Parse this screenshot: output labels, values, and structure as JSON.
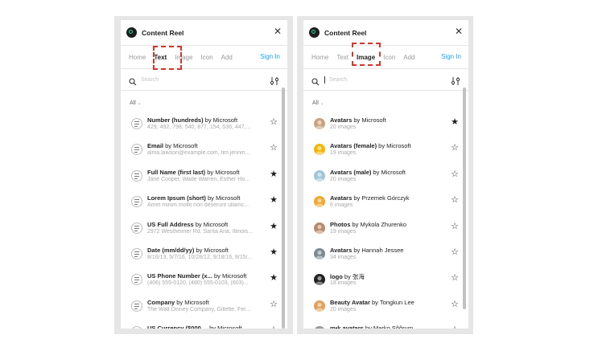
{
  "colors": {
    "accent": "#18a0fb",
    "highlight": "#d4362a",
    "frame": "#e6e6e6"
  },
  "panels": [
    {
      "title": "Content Reel",
      "close_icon": "close-icon",
      "tabs": [
        "Home",
        "Text",
        "Image",
        "Icon",
        "Add"
      ],
      "active_tab": "Text",
      "signin": "Sign In",
      "search_placeholder": "Search",
      "filter": "All",
      "items": [
        {
          "name": "Number (hundreds)",
          "by": " by Microsoft",
          "sub": "429, 492, 798, 540, 877, 154, 536, 447,...",
          "starred": false
        },
        {
          "name": "Email",
          "by": " by Microsoft",
          "sub": "alma.lawson@example.com, tim.jennin...",
          "starred": false
        },
        {
          "name": "Full Name (first last)",
          "by": " by Microsoft",
          "sub": "Jane Cooper, Wade Warren, Esther Ho...",
          "starred": true
        },
        {
          "name": "Lorem Ipsum (short)",
          "by": " by Microsoft",
          "sub": "Amet minim mollit non deserunt ullamc...",
          "starred": true
        },
        {
          "name": "US Full Address",
          "by": " by Microsoft",
          "sub": "2972 Westheimer Rd. Santa Ana, Illinois...",
          "starred": true
        },
        {
          "name": "Date (mm/dd/yy)",
          "by": " by Microsoft",
          "sub": "8/16/13, 5/7/16, 10/28/12, 9/18/16, 8/15/...",
          "starred": true
        },
        {
          "name": "US Phone Number (x...",
          "by": " by Microsoft",
          "sub": "(406) 555-0120, (480) 555-0103, (603)...",
          "starred": true
        },
        {
          "name": "Company",
          "by": " by Microsoft",
          "sub": "The Walt Disney Company, Gillette, Fer...",
          "starred": false
        },
        {
          "name": "US Currency ($000....",
          "by": " by Microsoft",
          "sub": "",
          "starred": false
        }
      ]
    },
    {
      "title": "Content Reel",
      "close_icon": "close-icon",
      "tabs": [
        "Home",
        "Text",
        "Image",
        "Icon",
        "Add"
      ],
      "active_tab": "Image",
      "signin": "Sign In",
      "search_placeholder": "Search",
      "filter": "All",
      "items": [
        {
          "name": "Avatars",
          "by": " by Microsoft",
          "sub": "20 images",
          "starred": true,
          "avatar": "#c9a27e"
        },
        {
          "name": "Avatars (female)",
          "by": " by Microsoft",
          "sub": "19 images",
          "starred": false,
          "avatar": "#f2b705"
        },
        {
          "name": "Avatars (male)",
          "by": " by Microsoft",
          "sub": "20 images",
          "starred": false,
          "avatar": "#9ec5d8"
        },
        {
          "name": "Avatars",
          "by": " by Przemek Górczyk",
          "sub": "6 images",
          "starred": false,
          "avatar": "#f0a830"
        },
        {
          "name": "Photos",
          "by": " by Mykola Zhurenko",
          "sub": "19 images",
          "starred": false,
          "avatar": "#b88a6b"
        },
        {
          "name": "Avatars",
          "by": " by Hannah Jessee",
          "sub": "34 images",
          "starred": false,
          "avatar": "#7d8a91"
        },
        {
          "name": "logo",
          "by": " by 张海",
          "sub": "18 images",
          "starred": false,
          "avatar": "#222222"
        },
        {
          "name": "Beauty Avatar",
          "by": " by Tongkun Lee",
          "sub": "20 images",
          "starred": false,
          "avatar": "#e0a15a"
        },
        {
          "name": "m•k avatars",
          "by": " by Marko Sõõrum",
          "sub": "",
          "starred": false,
          "avatar": "#999999"
        }
      ]
    }
  ]
}
